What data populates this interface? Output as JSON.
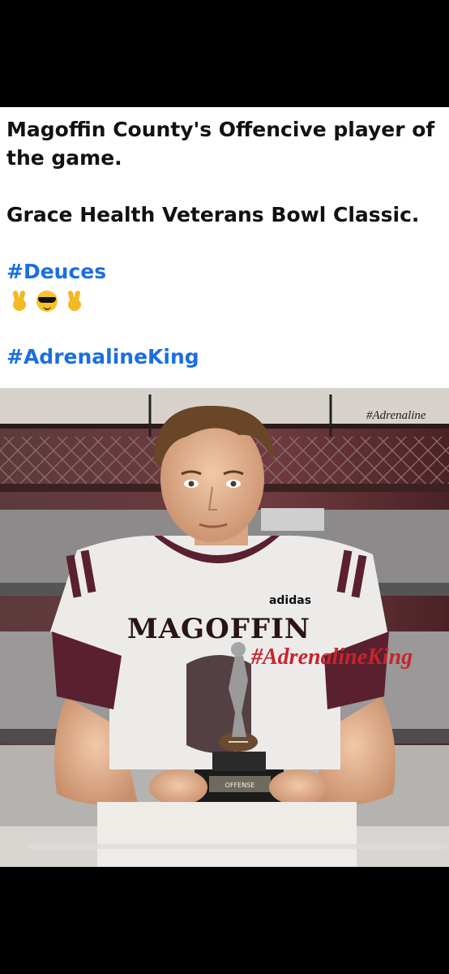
{
  "post": {
    "title_line1": "Magoffin County's Offencive player of",
    "title_line2": "the game.",
    "event": "Grace Health Veterans Bowl Classic.",
    "hashtag1": "#Deuces",
    "hashtag2": "#AdrenalineKing",
    "emojis": [
      "victory-hand-icon",
      "smiling-face-sunglasses-icon",
      "victory-hand-icon"
    ]
  },
  "photo": {
    "jersey_text": "MAGOFFIN",
    "brand_text": "adidas",
    "watermark_top": "#Adrenaline",
    "watermark_main": "#AdrenalineKing",
    "trophy_plate": "OFFENSE"
  },
  "colors": {
    "hashtag": "#1a6fe0",
    "maroon": "#5a2030",
    "background": "#000000"
  }
}
